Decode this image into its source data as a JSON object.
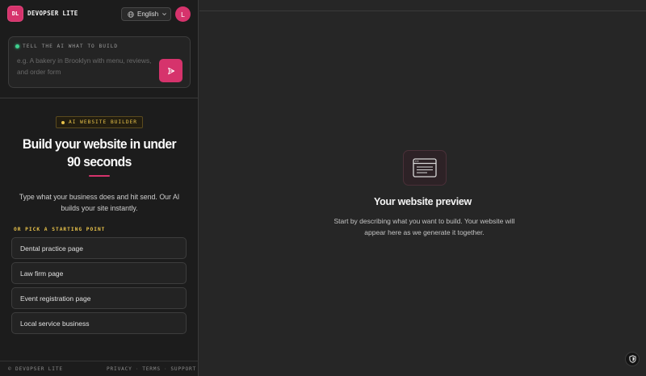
{
  "app": {
    "logo_text": "DL",
    "brand": "DEVOPSER LITE",
    "language": "English",
    "avatar_initial": "L"
  },
  "prompt": {
    "label": "TELL THE AI WHAT TO BUILD",
    "placeholder": "e.g. A bakery in Brooklyn with menu, reviews, and order form",
    "value": "",
    "send_icon": "send-icon"
  },
  "hero": {
    "badge": "AI WEBSITE BUILDER",
    "headline_line1": "Build your website in under",
    "headline_line2": "90 seconds",
    "subtext": "Type what your business does and hit send. Our AI builds your site instantly."
  },
  "presets": {
    "label": "OR PICK A STARTING POINT",
    "items": [
      {
        "label": "Dental practice page"
      },
      {
        "label": "Law firm page"
      },
      {
        "label": "Event registration page"
      },
      {
        "label": "Local service business"
      }
    ]
  },
  "footer": {
    "brand": "© DEVOPSER LITE",
    "links": [
      "PRIVACY",
      "TERMS",
      "SUPPORT"
    ],
    "separator": "·"
  },
  "preview": {
    "title": "Your website preview",
    "text": "Start by describing what you want to build. Your website will appear here as we generate it together.",
    "icon": "browser-window-icon"
  },
  "colors": {
    "accent": "#d6336c",
    "badge": "#e8c24a",
    "status": "#3ecf8e",
    "background": "#262626",
    "sidebar": "#1c1c1c"
  }
}
